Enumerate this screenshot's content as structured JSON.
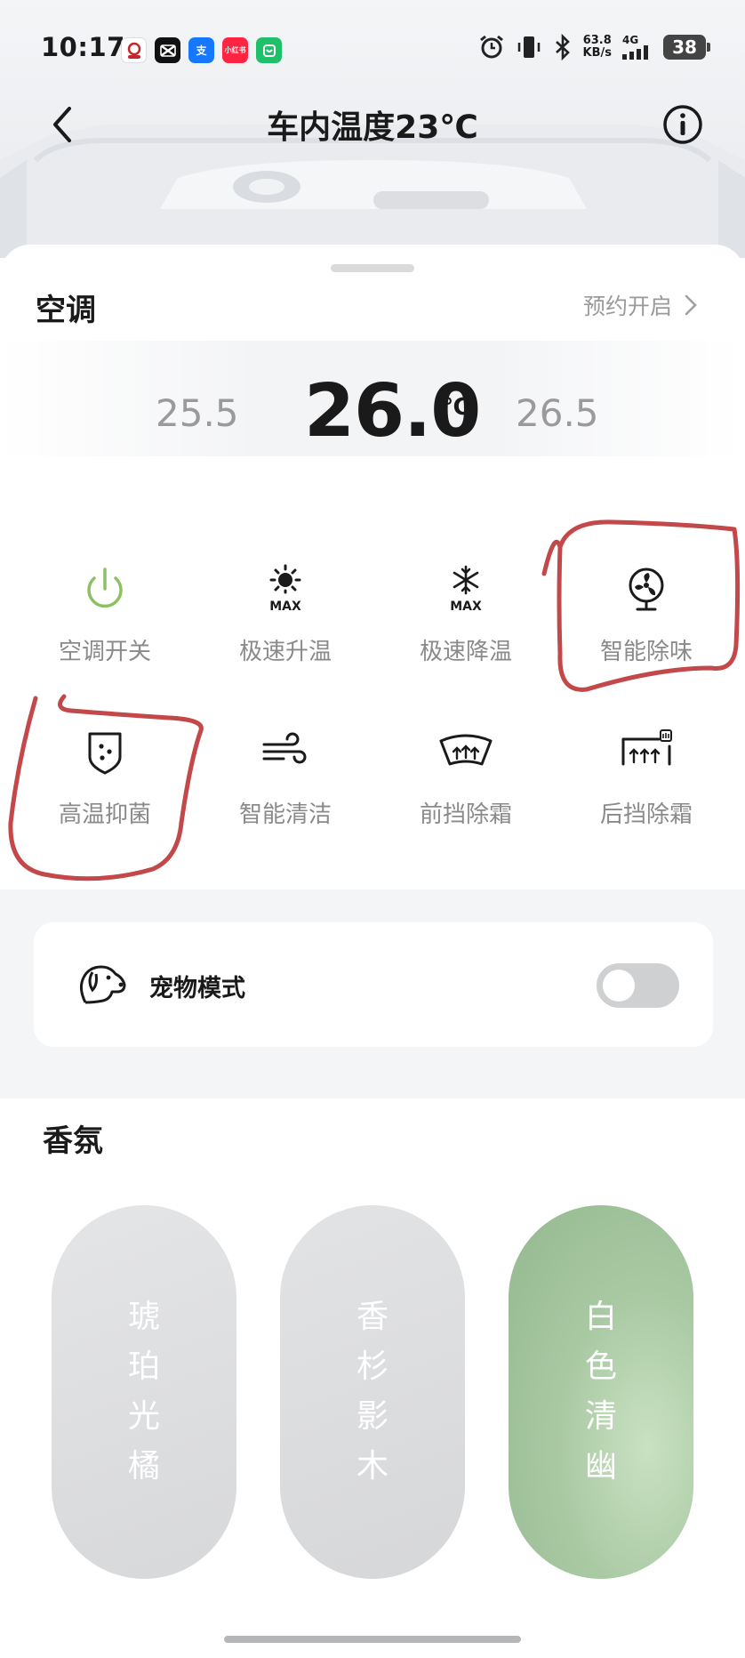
{
  "status_bar": {
    "time": "10:17",
    "net_speed_value": "63.8",
    "net_speed_unit": "KB/s",
    "network": "4G",
    "battery": "38",
    "app_icons": [
      "cn-bank-icon",
      "capcut-icon",
      "alipay-icon",
      "xiaohongshu-icon",
      "mijia-icon"
    ],
    "app_labels": [
      "",
      "",
      "支",
      "小红书",
      ""
    ]
  },
  "nav": {
    "title": "车内温度23℃"
  },
  "ac": {
    "title": "空调",
    "schedule_label": "预约开启",
    "temp_prev": "25.5",
    "temp_current": "26.0",
    "temp_unit": "℃",
    "temp_next": "26.5"
  },
  "functions": [
    {
      "label": "空调开关",
      "icon": "power-icon"
    },
    {
      "label": "极速升温",
      "icon": "sun-max-icon",
      "badge": "MAX"
    },
    {
      "label": "极速降温",
      "icon": "snowflake-max-icon",
      "badge": "MAX"
    },
    {
      "label": "智能除味",
      "icon": "fan-icon"
    },
    {
      "label": "高温抑菌",
      "icon": "shield-dots-icon"
    },
    {
      "label": "智能清洁",
      "icon": "wind-icon"
    },
    {
      "label": "前挡除霜",
      "icon": "front-defrost-icon"
    },
    {
      "label": "后挡除霜",
      "icon": "rear-defrost-icon"
    }
  ],
  "pet_mode": {
    "label": "宠物模式",
    "enabled": false
  },
  "fragrance": {
    "title": "香氛",
    "items": [
      {
        "name": "琥珀光橘",
        "chars": [
          "琥",
          "珀",
          "光",
          "橘"
        ],
        "selected": false
      },
      {
        "name": "香杉影木",
        "chars": [
          "香",
          "杉",
          "影",
          "木"
        ],
        "selected": false
      },
      {
        "name": "白色清幽",
        "chars": [
          "白",
          "色",
          "清",
          "幽"
        ],
        "selected": true
      }
    ]
  },
  "colors": {
    "power_green": "#8cc063",
    "annotation_red": "#c2484a",
    "selected_scent": "#a9c9a3"
  }
}
